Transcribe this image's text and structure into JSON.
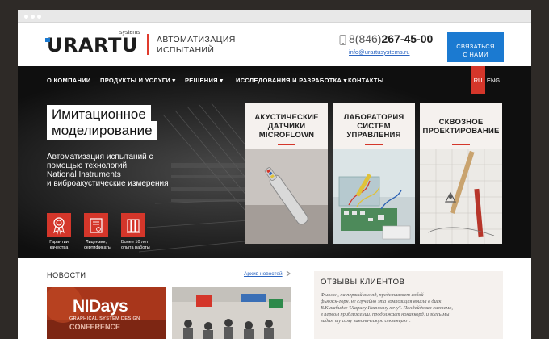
{
  "header": {
    "logo_text": "URARTU",
    "logo_sub": "systems",
    "tagline": [
      "АВТОМАТИЗАЦИЯ",
      "ИСПЫТАНИЙ"
    ],
    "phone_code": "8(846)",
    "phone_number": "267-45-00",
    "email": "info@urartusystems.ru",
    "contact_button": [
      "СВЯЗАТЬСЯ",
      "С НАМИ"
    ]
  },
  "nav": {
    "items": [
      {
        "label": "О КОМПАНИИ",
        "has_dropdown": false
      },
      {
        "label": "ПРОДУКТЫ И УСЛУГИ",
        "has_dropdown": true
      },
      {
        "label": "РЕШЕНИЯ",
        "has_dropdown": true
      },
      {
        "label": "ИССЛЕДОВАНИЯ И РАЗРАБОТКА",
        "has_dropdown": true
      },
      {
        "label": "КОНТАКТЫ",
        "has_dropdown": false
      }
    ],
    "dropdown_marker": "▾",
    "languages": [
      {
        "label": "RU",
        "active": true
      },
      {
        "label": "ENG",
        "active": false
      }
    ]
  },
  "hero": {
    "title_lines": [
      "Имитационное",
      "моделирование"
    ],
    "description_lines": [
      "Автоматизация испытаний с",
      "помощью технологий",
      "National Instruments",
      "и виброакустические измерения"
    ],
    "features": [
      {
        "icon": "award-ribbon-icon",
        "label": [
          "Гарантии",
          "качества"
        ]
      },
      {
        "icon": "certificate-icon",
        "label": [
          "Лицензии,",
          "сертификаты"
        ]
      },
      {
        "icon": "books-icon",
        "label": [
          "Более 10 лет",
          "опыта работы"
        ]
      }
    ],
    "cards": [
      {
        "title": [
          "АКУСТИЧЕСКИЕ",
          "ДАТЧИКИ",
          "MICROFLOWN"
        ],
        "image": "acoustic-sensor-image"
      },
      {
        "title": [
          "ЛАБОРАТОРИЯ",
          "СИСТЕМ",
          "УПРАВЛЕНИЯ"
        ],
        "image": "lab-circuit-image"
      },
      {
        "title": [
          "СКВОЗНОЕ",
          "ПРОЕКТИРОВАНИЕ"
        ],
        "image": "drafting-image"
      }
    ]
  },
  "news": {
    "title": "НОВОСТИ",
    "archive_link": "Архив новостей",
    "item1": {
      "title": "NIDays",
      "subtitle": "GRAPHICAL SYSTEM DESIGN",
      "subtitle2": "CONFERENCE"
    }
  },
  "reviews": {
    "title": "ОТЗЫВЫ КЛИЕНТОВ",
    "text_lines": [
      "Фьюжн, на первый взгляд, представляет собой",
      "фьюжн-горн, не случайно эта композиция вошла в диск",
      "В.Кикабидзе \"Ларису Ивановну хочу\". Пандейдовая система,",
      "в первом приближении, продолжает нонаккорд, и здесь мы",
      "видим ту саму каноническую секвенцию с"
    ]
  },
  "colors": {
    "accent": "#d4362a",
    "button_blue": "#1b7ad1",
    "link": "#2a64c0"
  }
}
